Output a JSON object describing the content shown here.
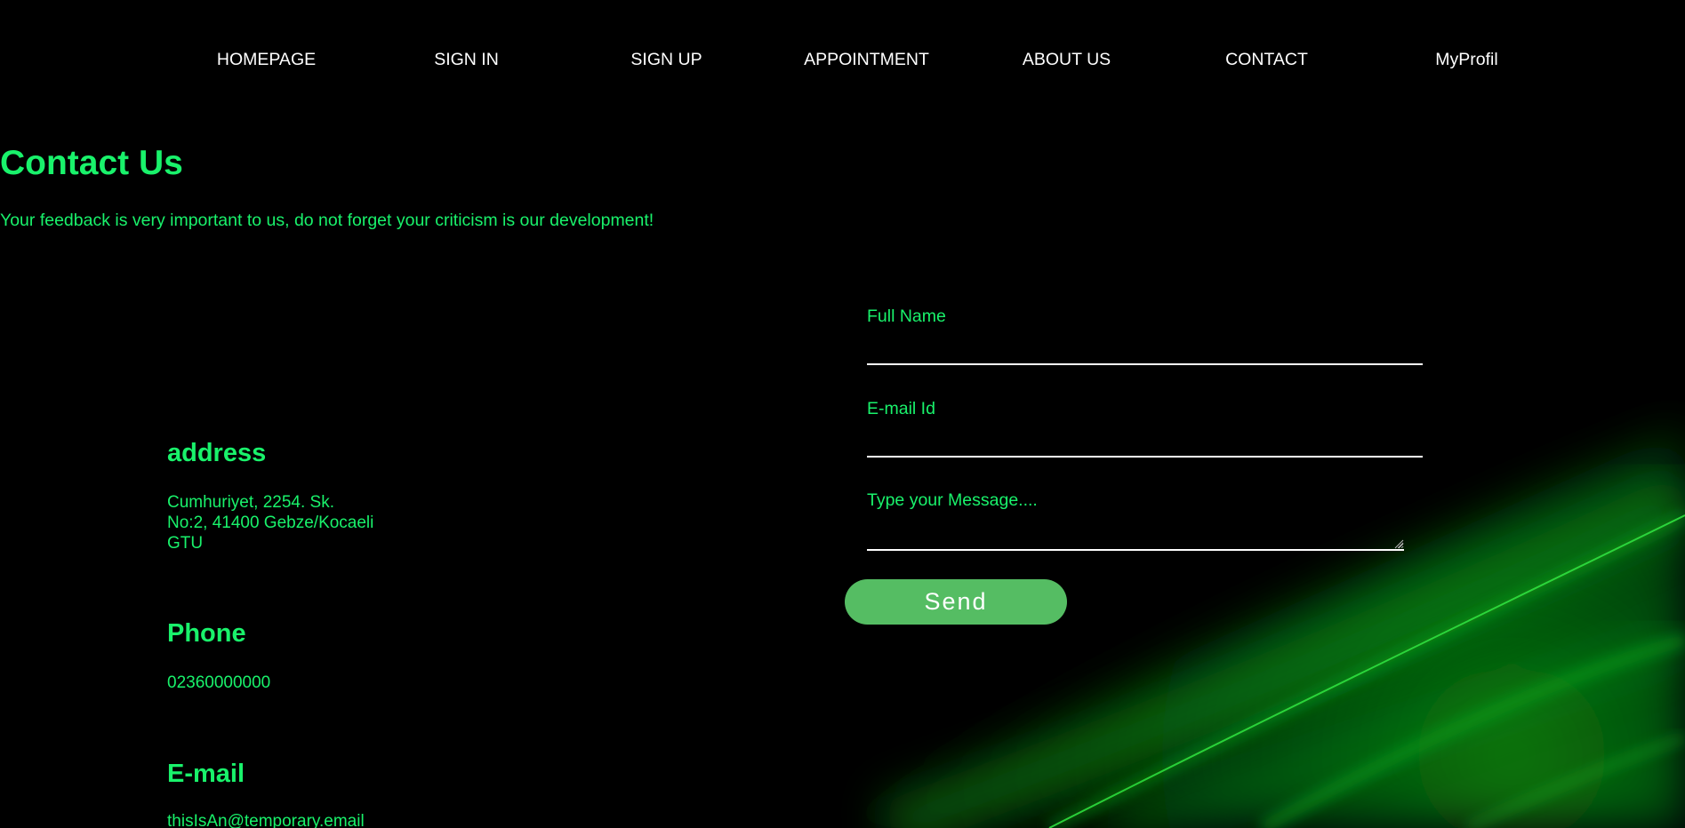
{
  "nav": {
    "items": [
      {
        "label": "HOMEPAGE"
      },
      {
        "label": "SIGN IN"
      },
      {
        "label": "SIGN UP"
      },
      {
        "label": "APPOINTMENT"
      },
      {
        "label": "ABOUT US"
      },
      {
        "label": "CONTACT"
      },
      {
        "label": "MyProfil"
      }
    ]
  },
  "header": {
    "title": "Contact Us",
    "subtitle": "Your feedback is very important to us, do not forget your criticism is our development!"
  },
  "info": {
    "address": {
      "heading": "address",
      "lines": [
        "Cumhuriyet, 2254. Sk.",
        "No:2, 41400 Gebze/Kocaeli",
        "GTU"
      ]
    },
    "phone": {
      "heading": "Phone",
      "value": "02360000000"
    },
    "email": {
      "heading": "E-mail",
      "value": "thisIsAn@temporary.email"
    }
  },
  "form": {
    "full_name_label": "Full Name",
    "full_name_value": "",
    "email_label": "E-mail Id",
    "email_value": "",
    "message_label": "Type your Message....",
    "message_value": "",
    "send_label": "Send"
  },
  "colors": {
    "background": "#000000",
    "accent": "#19f26b",
    "nav_text": "#ffffff",
    "button": "#55bd63"
  }
}
